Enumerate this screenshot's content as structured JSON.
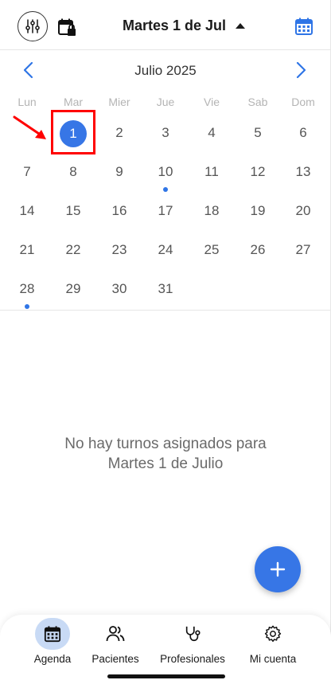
{
  "header": {
    "title": "Martes 1 de Jul",
    "filter_icon": "sliders-icon",
    "lock_calendar_icon": "calendar-lock-icon",
    "calendar_icon": "calendar-icon"
  },
  "calendar": {
    "month_label": "Julio 2025",
    "weekdays": [
      "Lun",
      "Mar",
      "Mier",
      "Jue",
      "Vie",
      "Sab",
      "Dom"
    ],
    "weeks": [
      [
        "",
        "1",
        "2",
        "3",
        "4",
        "5",
        "6"
      ],
      [
        "7",
        "8",
        "9",
        "10",
        "11",
        "12",
        "13"
      ],
      [
        "14",
        "15",
        "16",
        "17",
        "18",
        "19",
        "20"
      ],
      [
        "21",
        "22",
        "23",
        "24",
        "25",
        "26",
        "27"
      ],
      [
        "28",
        "29",
        "30",
        "31",
        "",
        "",
        ""
      ]
    ],
    "selected_day": "1",
    "days_with_events": [
      "10",
      "28"
    ]
  },
  "empty_state": {
    "line1": "No hay turnos asignados para",
    "line2": "Martes 1 de Julio"
  },
  "bottom_nav": {
    "tabs": [
      {
        "label": "Agenda",
        "icon": "calendar-icon",
        "active": true
      },
      {
        "label": "Pacientes",
        "icon": "users-icon",
        "active": false
      },
      {
        "label": "Profesionales",
        "icon": "stethoscope-icon",
        "active": false
      },
      {
        "label": "Mi cuenta",
        "icon": "gear-icon",
        "active": false
      }
    ]
  },
  "colors": {
    "accent": "#3776e6",
    "annotation": "#ff0000"
  }
}
